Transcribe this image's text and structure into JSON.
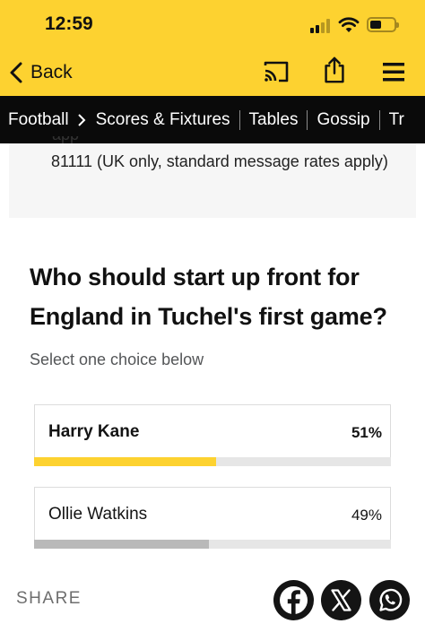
{
  "status_bar": {
    "time": "12:59"
  },
  "header": {
    "back_label": "Back"
  },
  "breadcrumb": {
    "items": [
      "Football",
      "Scores & Fixtures",
      "Tables",
      "Gossip",
      "Tr"
    ]
  },
  "info_box": {
    "cut_text": "app",
    "text": "81111 (UK only, standard message rates apply)"
  },
  "poll": {
    "question": "Who should start up front for England in Tuchel's first game?",
    "hint": "Select one choice below",
    "choices": [
      {
        "name": "Harry Kane",
        "percent_label": "51%",
        "percent": 51,
        "bar_color": "#fdd230"
      },
      {
        "name": "Ollie Watkins",
        "percent_label": "49%",
        "percent": 49,
        "bar_color": "#b9b9b9"
      }
    ]
  },
  "share": {
    "label": "SHARE",
    "icons": [
      "facebook-icon",
      "x-icon",
      "whatsapp-icon"
    ]
  },
  "colors": {
    "brand_yellow": "#fdd230",
    "nav_black": "#0a0a0a"
  }
}
